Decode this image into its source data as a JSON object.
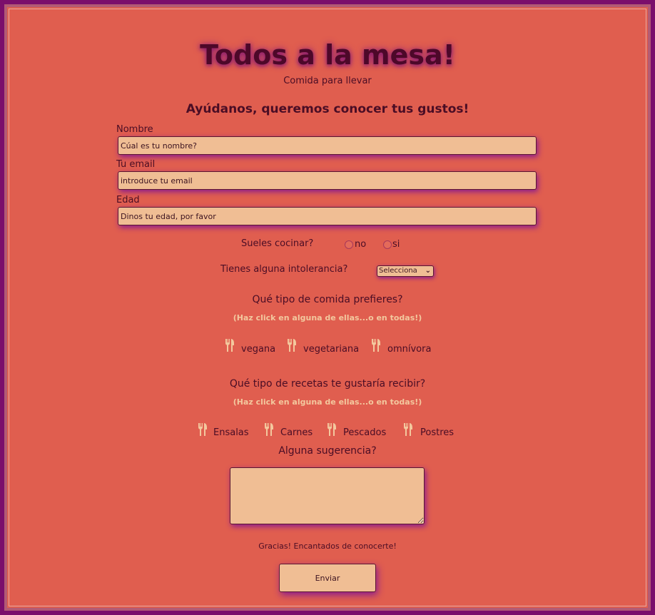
{
  "header": {
    "title": "Todos a la mesa!",
    "subtitle": "Comida para llevar",
    "heading": "Ayúdanos, queremos conocer tus gustos!"
  },
  "fields": {
    "name": {
      "label": "Nombre",
      "placeholder": "Cúal es tu nombre?"
    },
    "email": {
      "label": "Tu email",
      "placeholder": "introduce tu email"
    },
    "age": {
      "label": "Edad",
      "placeholder": "Dinos tu edad, por favor"
    }
  },
  "cooking": {
    "label": "Sueles cocinar?",
    "options": [
      "no",
      "si"
    ]
  },
  "intolerance": {
    "label": "Tienes alguna intolerancia?",
    "selected": "Selecciona"
  },
  "food_type": {
    "question": "Qué tipo de comida prefieres?",
    "hint": "(Haz click en alguna de ellas...o en todas!)",
    "options": [
      "vegana",
      "vegetariana",
      "omnívora"
    ]
  },
  "recipes": {
    "question": "Qué tipo de recetas te gustaría recibir?",
    "hint": "(Haz click en alguna de ellas...o en todas!)",
    "options": [
      "Ensalas",
      "Carnes",
      "Pescados",
      "Postres"
    ]
  },
  "suggestion": {
    "label": "Alguna sugerencia?"
  },
  "footer": {
    "thanks": "Gracias! Encantados de conocerte!",
    "submit_label": "Enviar"
  },
  "colors": {
    "background": "#e05e4f",
    "border": "#7b0e6b",
    "field": "#f0be94",
    "text": "#4a0d25",
    "icon": "#f3c89e"
  },
  "icons": {
    "food_option": "fork-knife-icon"
  }
}
